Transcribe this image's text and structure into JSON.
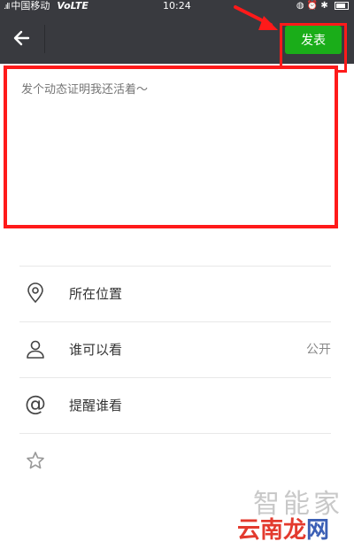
{
  "status_bar": {
    "signal": ".ıll",
    "carrier": "中国移动",
    "network": "VoLTE",
    "time": "10:24",
    "icons": "◍ ⏰ ✱"
  },
  "header": {
    "publish_label": "发表"
  },
  "compose": {
    "placeholder": "发个动态证明我还活着～"
  },
  "options": [
    {
      "label": "所在位置",
      "icon": "location-pin-icon"
    },
    {
      "label": "谁可以看",
      "value": "公开",
      "icon": "person-icon"
    },
    {
      "label": "提醒谁看",
      "icon": "at-icon"
    },
    {
      "label": "",
      "icon": "star-icon"
    }
  ],
  "watermark": {
    "top": "智能家",
    "bottom_a": "云南龙",
    "bottom_b": "网"
  },
  "colors": {
    "header_bg": "#393a3f",
    "publish_green": "#1aad19",
    "annotation_red": "#ff1a1a"
  }
}
